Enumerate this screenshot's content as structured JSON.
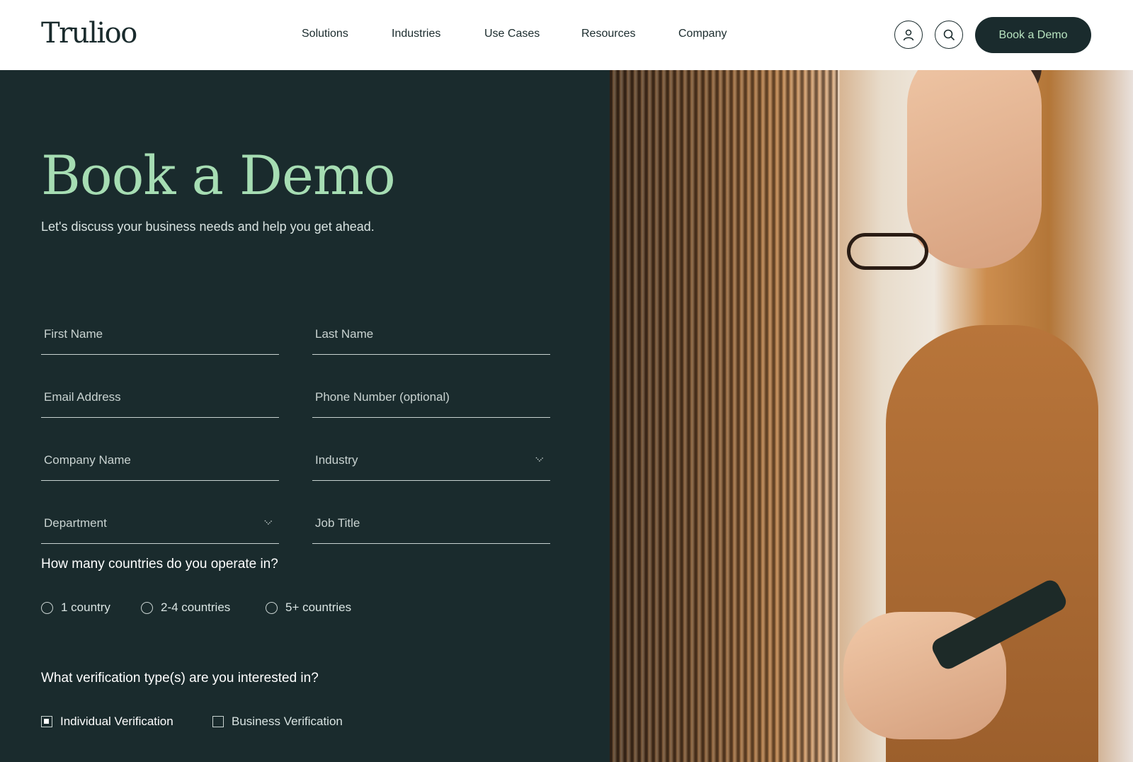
{
  "header": {
    "logo": "Trulioo",
    "nav": [
      "Solutions",
      "Industries",
      "Use Cases",
      "Resources",
      "Company"
    ],
    "account_icon": "user-icon",
    "search_icon": "search-icon",
    "cta_label": "Book a Demo"
  },
  "hero": {
    "title": "Book a Demo",
    "subtitle": "Let's discuss your business needs and help you get ahead."
  },
  "form": {
    "first_name": "First Name",
    "last_name": "Last Name",
    "email": "Email Address",
    "phone": "Phone Number (optional)",
    "company": "Company Name",
    "industry": "Industry",
    "department": "Department",
    "job_title": "Job Title",
    "countries_question": "How many countries do you operate in?",
    "countries_options": [
      "1 country",
      "2-4 countries",
      "5+ countries"
    ],
    "verification_question": "What verification type(s) are you interested in?",
    "verification_options": [
      {
        "label": "Individual Verification",
        "checked": true
      },
      {
        "label": "Business Verification",
        "checked": false
      }
    ]
  },
  "colors": {
    "brand_dark": "#1a2b2d",
    "accent_green": "#a6ddb3"
  }
}
